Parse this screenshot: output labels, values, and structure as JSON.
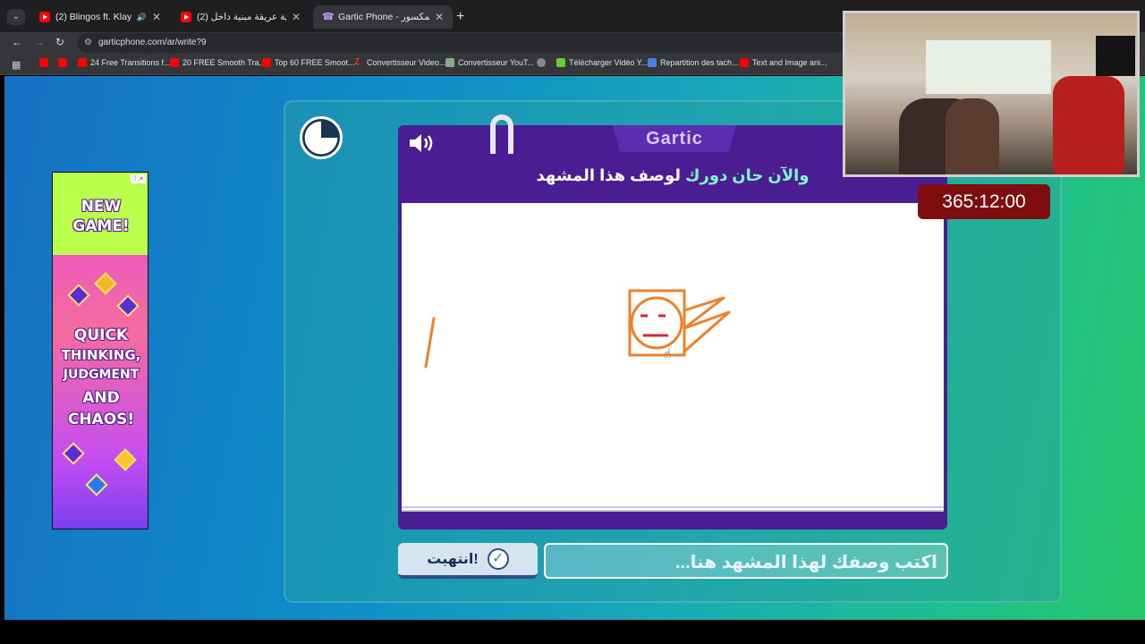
{
  "browser": {
    "tabs": [
      {
        "title": "(2) Blingos ft. Klay Bbj - Rb...",
        "audio": true,
        "favicon": "youtube-icon"
      },
      {
        "title": "(2) مدينة عربية عريقة مبنية داخل",
        "favicon": "youtube-icon"
      },
      {
        "title": "Gartic Phone - الهاتف المكسور",
        "favicon": "gartic-icon",
        "active": true
      }
    ],
    "url": "garticphone.com/ar/write?9",
    "bookmarks": [
      "24 Free Transitions f...",
      "20 FREE Smooth Tra...",
      "Top 60 FREE Smoot...",
      "Convertisseur Video...",
      "Convertisseur YouT...",
      "Télécharger Vidéo Y...",
      "Repartition des tach...",
      "Text and Image ani..."
    ]
  },
  "game": {
    "logo": "Gartic",
    "instruction_part1": "والآن حان دورك",
    "instruction_part2": "لوصف هذا المشهد",
    "done_button": "انتهيت!",
    "description_placeholder": "اكتب وصفك لهذا المشهد هنا..."
  },
  "ad": {
    "line1": "NEW",
    "line2": "GAME!",
    "line3": "QUICK",
    "line4": "THINKING,",
    "line5": "JUDGMENT",
    "line6": "AND",
    "line7": "CHAOS!"
  },
  "overlay": {
    "timer": "365:12:00"
  },
  "colors": {
    "card": "#4b1d93",
    "accent": "#7ef7c7",
    "drawing": "#f07f2a",
    "timer_bg": "#7e0d0f"
  }
}
